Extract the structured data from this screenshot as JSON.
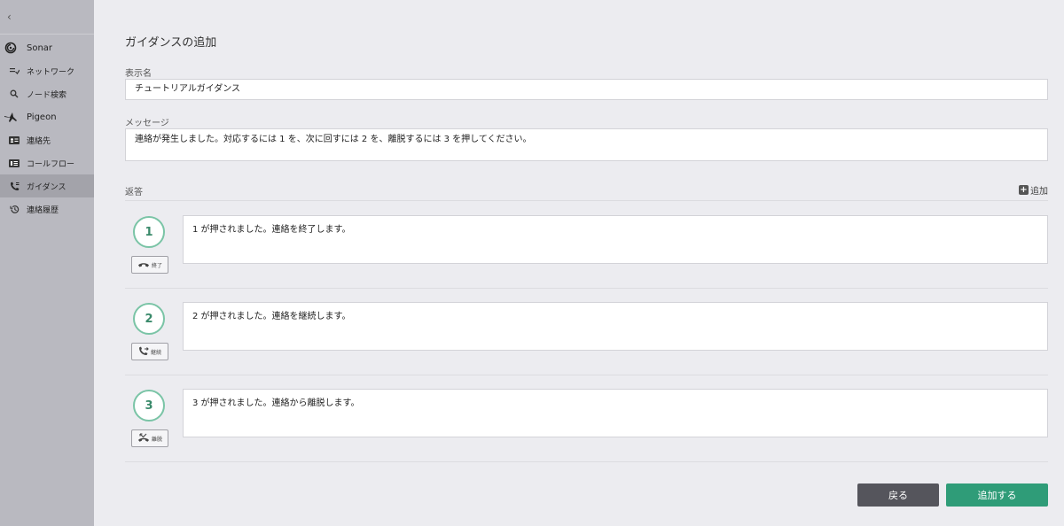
{
  "sidebar": {
    "collapse_glyph": "‹",
    "items": [
      {
        "label": "Sonar",
        "icon": "sonar-icon"
      },
      {
        "label": "ネットワーク",
        "icon": "network-icon"
      },
      {
        "label": "ノード検索",
        "icon": "search-icon"
      },
      {
        "label": "Pigeon",
        "icon": "pigeon-icon"
      },
      {
        "label": "連絡先",
        "icon": "contact-card-icon"
      },
      {
        "label": "コールフロー",
        "icon": "callflow-icon"
      },
      {
        "label": "ガイダンス",
        "icon": "phone-guidance-icon",
        "active": true
      },
      {
        "label": "連絡履歴",
        "icon": "history-icon"
      }
    ]
  },
  "main": {
    "title": "ガイダンスの追加",
    "display_name": {
      "label": "表示名",
      "value": "チュートリアルガイダンス"
    },
    "message": {
      "label": "メッセージ",
      "value": "連絡が発生しました。対応するには 1 を、次に回すには 2 を、離脱するには 3 を押してください。"
    },
    "responses": {
      "label": "返答",
      "add_label": "追加",
      "items": [
        {
          "number": "1",
          "action": "終了",
          "action_icon": "hangup-icon",
          "text": "1 が押されました。連絡を終了します。"
        },
        {
          "number": "2",
          "action": "継続",
          "action_icon": "forward-call-icon",
          "text": "2 が押されました。連絡を継続します。"
        },
        {
          "number": "3",
          "action": "離脱",
          "action_icon": "missed-call-icon",
          "text": "3 が押されました。連絡から離脱します。"
        }
      ]
    },
    "buttons": {
      "back": "戻る",
      "submit": "追加する"
    }
  },
  "colors": {
    "accent": "#2f9c78",
    "circle_border": "#7ac4a6",
    "sidebar_bg": "#b9b9c0",
    "back_button": "#55555c"
  }
}
